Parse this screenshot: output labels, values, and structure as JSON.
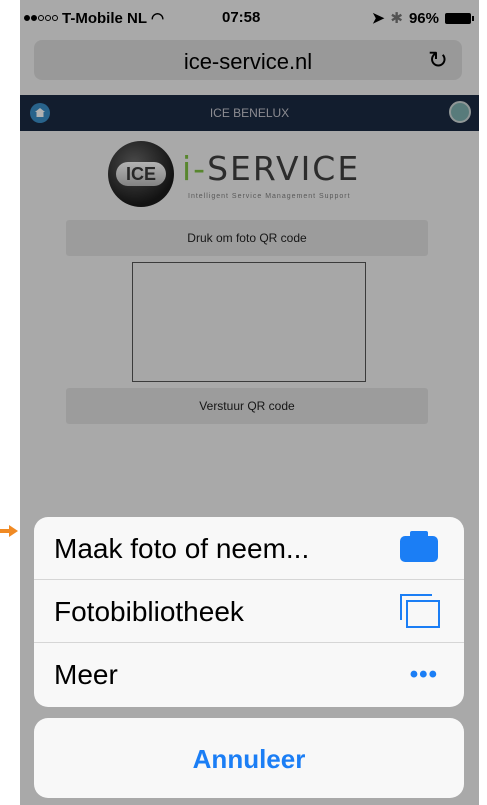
{
  "status_bar": {
    "carrier": "T-Mobile NL",
    "time": "07:58",
    "battery": "96%"
  },
  "browser": {
    "url": "ice-service.nl"
  },
  "app_header": {
    "title": "ICE BENELUX"
  },
  "logo": {
    "circle_text": "ICE",
    "title_prefix": "i-",
    "title_rest": "SERVICE",
    "subtitle": "Intelligent Service Management Support"
  },
  "main": {
    "photo_button_label": "Druk om foto QR code",
    "send_button_label": "Verstuur QR code"
  },
  "action_sheet": {
    "items": [
      {
        "label": "Maak foto of neem...",
        "icon": "camera-icon"
      },
      {
        "label": "Fotobibliotheek",
        "icon": "photo-library-icon"
      },
      {
        "label": "Meer",
        "icon": "more-icon"
      }
    ],
    "cancel_label": "Annuleer"
  },
  "colors": {
    "accent": "#1b7ef5",
    "header_bg": "#1b2a42",
    "annotation_arrow": "#f08a24"
  }
}
